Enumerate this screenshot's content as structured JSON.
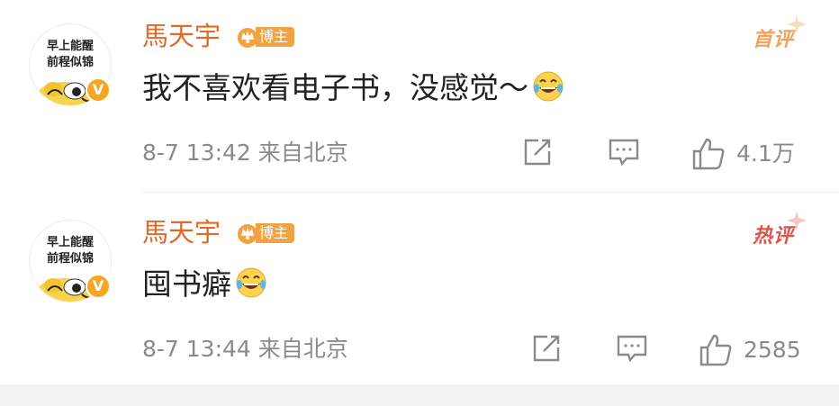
{
  "avatar_text": [
    "早上能醒",
    "前程似锦"
  ],
  "comments": [
    {
      "username": "馬天宇",
      "badge": "博主",
      "tag": "首评",
      "content": "我不喜欢看电子书，没感觉～",
      "emoji": "laugh-cry-emoji",
      "meta": "8-7 13:42  来自北京",
      "likes": "4.1万"
    },
    {
      "username": "馬天宇",
      "badge": "博主",
      "tag": "热评",
      "content": "囤书癖",
      "emoji": "laugh-cry-emoji",
      "meta": "8-7 13:44  来自北京",
      "likes": "2585"
    }
  ],
  "colors": {
    "username": "#e26928",
    "badge": "#f1a341",
    "tag_first": "#f0a35a",
    "tag_hot": "#e0534a",
    "meta": "#8a8a8a"
  },
  "icons": [
    "share-icon",
    "comment-icon",
    "like-icon"
  ]
}
